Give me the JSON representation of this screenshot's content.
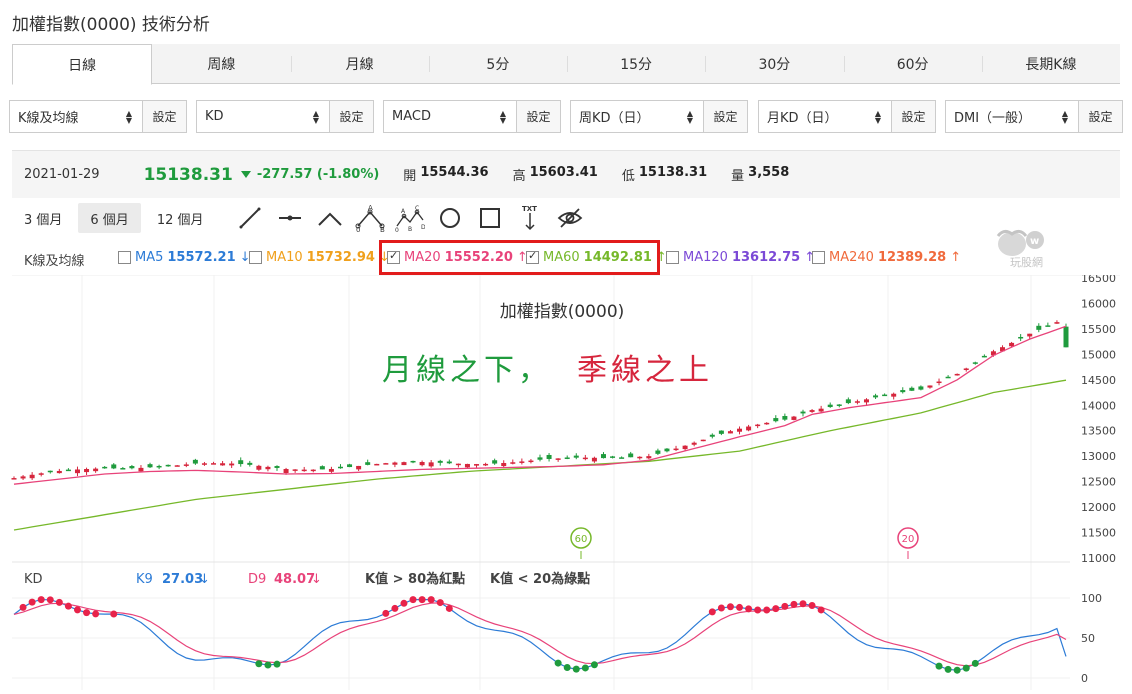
{
  "page": {
    "title": "加權指數(0000) 技術分析"
  },
  "tabs": [
    "日線",
    "周線",
    "月線",
    "5分",
    "15分",
    "30分",
    "60分",
    "長期K線"
  ],
  "selectors": [
    {
      "value": "K線及均線",
      "button": "設定"
    },
    {
      "value": "KD",
      "button": "設定"
    },
    {
      "value": "MACD",
      "button": "設定"
    },
    {
      "value": "周KD（日）",
      "button": "設定"
    },
    {
      "value": "月KD（日）",
      "button": "設定"
    },
    {
      "value": "DMI（一般）",
      "button": "設定"
    }
  ],
  "info": {
    "date": "2021-01-29",
    "price": "15138.31",
    "change": "-277.57 (-1.80%)",
    "open_label": "開",
    "open": "15544.36",
    "high_label": "高",
    "high": "15603.41",
    "low_label": "低",
    "low": "15138.31",
    "vol_label": "量",
    "vol": "3,558"
  },
  "periods": [
    "3 個月",
    "6 個月",
    "12 個月"
  ],
  "tools": [
    "line-icon",
    "segment-icon",
    "angle-icon",
    "abc-pattern-icon",
    "abcd-pattern-icon",
    "circle-icon",
    "rectangle-icon",
    "text-icon",
    "hide-icon"
  ],
  "ma": {
    "label": "K線及均線",
    "items": [
      {
        "name": "MA5",
        "value": "15572.21",
        "arrow": "↓",
        "color": "#2c7bd6",
        "checked": false
      },
      {
        "name": "MA10",
        "value": "15732.94",
        "arrow": "↓",
        "color": "#f0a01c",
        "checked": false
      },
      {
        "name": "MA20",
        "value": "15552.20",
        "arrow": "↑",
        "color": "#e8437a",
        "checked": true
      },
      {
        "name": "MA60",
        "value": "14492.81",
        "arrow": "↑",
        "color": "#76b82a",
        "checked": true
      },
      {
        "name": "MA120",
        "value": "13612.75",
        "arrow": "↑",
        "color": "#7b49d6",
        "checked": false
      },
      {
        "name": "MA240",
        "value": "12389.28",
        "arrow": "↑",
        "color": "#f06a3c",
        "checked": false
      }
    ]
  },
  "watermark": "玩股網",
  "main_chart": {
    "title": "加權指數(0000)",
    "annotation_green": "月線之下，",
    "annotation_red": "季線之上",
    "marker_60": "60",
    "marker_20": "20"
  },
  "kd": {
    "label": "KD",
    "k_label": "K9",
    "k_value": "27.03",
    "k_arrow": "↓",
    "d_label": "D9",
    "d_value": "48.07",
    "d_arrow": "↓",
    "note_red": "K值 > 80為紅點",
    "note_green": "K值 < 20為綠點"
  },
  "chart_data": [
    {
      "type": "candlestick",
      "title": "加權指數(0000)",
      "y_ticks": [
        11000,
        11500,
        12000,
        12500,
        13000,
        13500,
        14000,
        14500,
        15000,
        15500,
        16000,
        16500
      ],
      "ylim": [
        11000,
        16500
      ],
      "ma20_last": 15552.2,
      "ma60_last": 14492.81,
      "ma20_path": [
        [
          0,
          12450
        ],
        [
          5,
          12550
        ],
        [
          10,
          12650
        ],
        [
          15,
          12700
        ],
        [
          20,
          12720
        ],
        [
          25,
          12690
        ],
        [
          30,
          12650
        ],
        [
          35,
          12660
        ],
        [
          40,
          12700
        ],
        [
          45,
          12740
        ],
        [
          50,
          12760
        ],
        [
          55,
          12780
        ],
        [
          60,
          12800
        ],
        [
          65,
          12830
        ],
        [
          70,
          12920
        ],
        [
          75,
          13150
        ],
        [
          80,
          13380
        ],
        [
          85,
          13600
        ],
        [
          88,
          13820
        ],
        [
          92,
          13950
        ],
        [
          96,
          14050
        ],
        [
          100,
          14150
        ],
        [
          104,
          14500
        ],
        [
          108,
          14980
        ],
        [
          112,
          15300
        ],
        [
          116,
          15552
        ]
      ],
      "ma60_path": [
        [
          0,
          11550
        ],
        [
          10,
          11850
        ],
        [
          20,
          12150
        ],
        [
          30,
          12350
        ],
        [
          40,
          12550
        ],
        [
          50,
          12700
        ],
        [
          60,
          12800
        ],
        [
          70,
          12900
        ],
        [
          80,
          13100
        ],
        [
          90,
          13500
        ],
        [
          100,
          13850
        ],
        [
          108,
          14250
        ],
        [
          116,
          14493
        ]
      ],
      "candles_ohlc_sample": [
        {
          "date": "2021-01-29",
          "open": 15544.36,
          "high": 15603.41,
          "low": 15138.31,
          "close": 15138.31
        }
      ]
    },
    {
      "type": "line",
      "title": "KD",
      "y_ticks": [
        0,
        50,
        100
      ],
      "ylim": [
        0,
        100
      ],
      "series": [
        {
          "name": "K9",
          "last": 27.03
        },
        {
          "name": "D9",
          "last": 48.07
        }
      ],
      "red_dots_threshold": 80,
      "green_dots_threshold": 20
    }
  ],
  "colors": {
    "up": "#d6263d",
    "down": "#1f9b3d",
    "ma20": "#e8437a",
    "ma60": "#76b82a",
    "k": "#2c7bd6",
    "d": "#e8437a"
  }
}
